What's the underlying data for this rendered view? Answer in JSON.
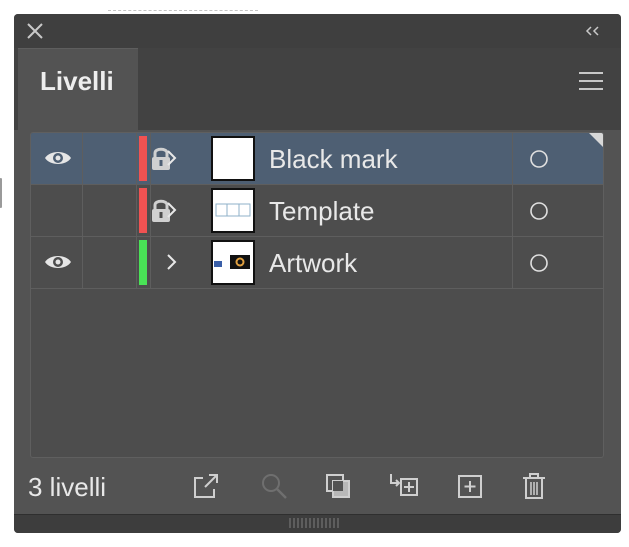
{
  "panel": {
    "tab_label": "Livelli",
    "count_label": "3 livelli"
  },
  "icons": {
    "close": "close-icon",
    "collapse": "double-chevron-left-icon",
    "menu": "hamburger-menu-icon",
    "eye": "eye-icon",
    "lock": "lock-icon",
    "expand": "chevron-right-icon",
    "target": "target-circle-icon"
  },
  "layers": [
    {
      "name": "Black mark",
      "visible": true,
      "locked": true,
      "color": "#f05252",
      "selected": true,
      "thumbnail": "blank"
    },
    {
      "name": "Template",
      "visible": false,
      "locked": true,
      "color": "#f05252",
      "selected": false,
      "thumbnail": "template"
    },
    {
      "name": "Artwork",
      "visible": true,
      "locked": false,
      "color": "#49e256",
      "selected": false,
      "thumbnail": "artwork"
    }
  ],
  "footer_buttons": [
    {
      "name": "export-for-screens-button",
      "icon": "export-arrow-icon",
      "enabled": true
    },
    {
      "name": "locate-object-button",
      "icon": "search-icon",
      "enabled": false
    },
    {
      "name": "make-clipping-mask-button",
      "icon": "clipping-mask-icon",
      "enabled": true
    },
    {
      "name": "create-sublayer-button",
      "icon": "new-sublayer-icon",
      "enabled": true
    },
    {
      "name": "create-layer-button",
      "icon": "new-layer-icon",
      "enabled": true
    },
    {
      "name": "delete-layer-button",
      "icon": "trash-icon",
      "enabled": true
    }
  ],
  "colors": {
    "panel_bg": "#535353",
    "selected_row": "#4e5f73",
    "text": "#e8e8e8"
  }
}
